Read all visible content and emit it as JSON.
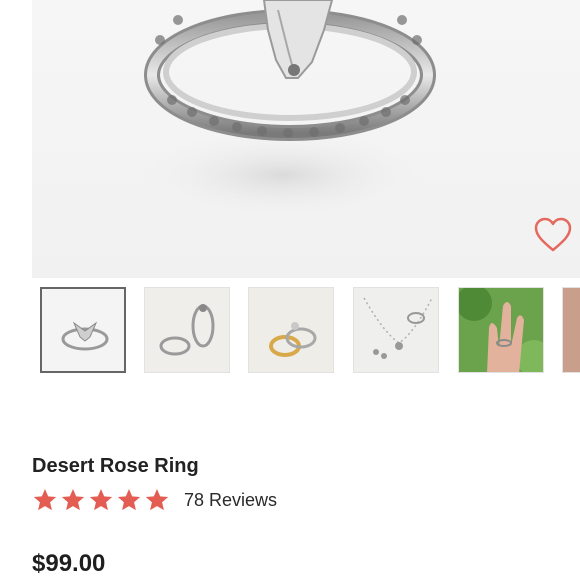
{
  "product": {
    "title": "Desert Rose Ring",
    "rating": {
      "stars": 5,
      "max": 5,
      "reviews_label": "78 Reviews"
    },
    "price": "$99.00"
  },
  "gallery": {
    "main_image": "ring-main-image",
    "thumbnails": [
      {
        "name": "ring-silver",
        "active": true
      },
      {
        "name": "ring-two-views",
        "active": false
      },
      {
        "name": "ring-gold",
        "active": false
      },
      {
        "name": "ring-necklace-earrings-set",
        "active": false
      },
      {
        "name": "ring-on-hand",
        "active": false
      },
      {
        "name": "ring-partial",
        "active": false
      }
    ]
  },
  "icons": {
    "wishlist": "heart-icon",
    "star": "star-icon"
  },
  "colors": {
    "accent": "#e4685d",
    "star": "#e35d52",
    "text": "#1f1f1f"
  }
}
